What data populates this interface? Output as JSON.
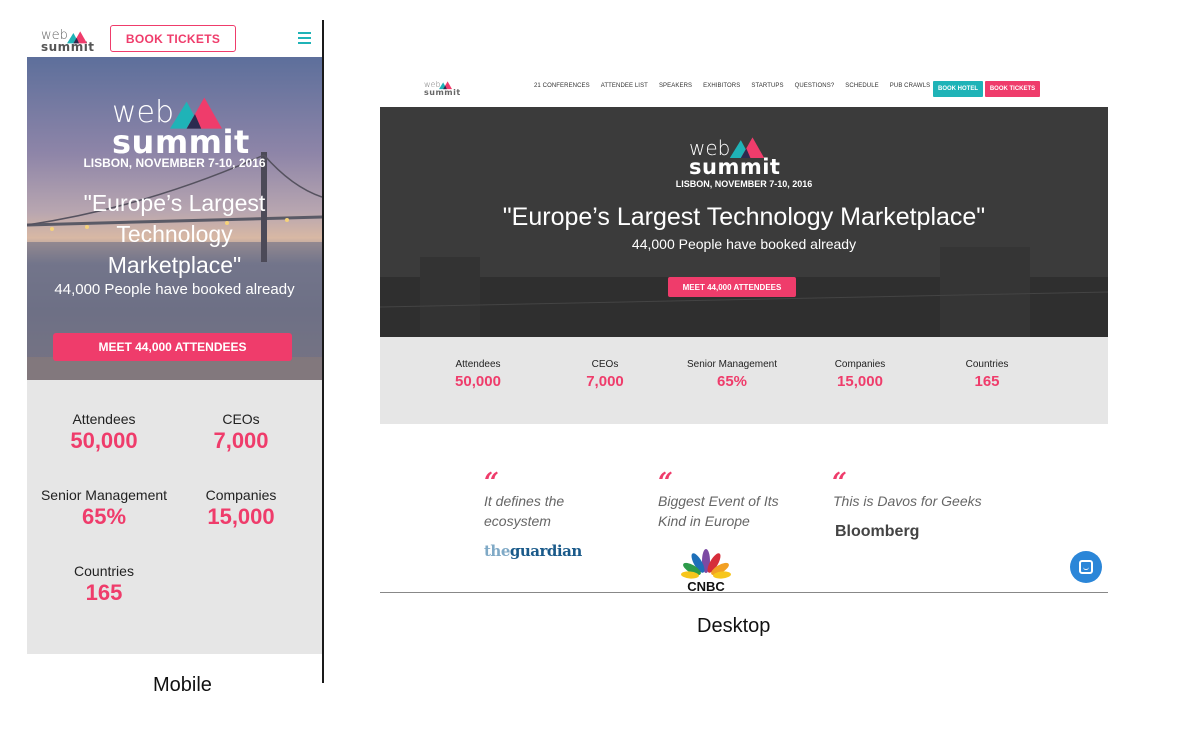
{
  "logo": {
    "word1": "web",
    "word2": "summit"
  },
  "colors": {
    "pink": "#ef3c6b",
    "teal": "#1fb3b7",
    "stats_bg": "#e6e6e6"
  },
  "mobile": {
    "book_tickets": "BOOK TICKETS",
    "date": "LISBON, NOVEMBER 7-10, 2016",
    "quote": "\"Europe’s Largest Technology Marketplace\"",
    "booked": "44,000 People have booked already",
    "meet": "MEET 44,000 ATTENDEES",
    "stats": [
      {
        "label": "Attendees",
        "value": "50,000"
      },
      {
        "label": "CEOs",
        "value": "7,000"
      },
      {
        "label": "Senior Management",
        "value": "65%"
      },
      {
        "label": "Companies",
        "value": "15,000"
      },
      {
        "label": "Countries",
        "value": "165"
      }
    ],
    "caption": "Mobile"
  },
  "desktop": {
    "nav": [
      "21 CONFERENCES",
      "ATTENDEE LIST",
      "SPEAKERS",
      "EXHIBITORS",
      "STARTUPS",
      "QUESTIONS?",
      "SCHEDULE",
      "PUB CRAWLS"
    ],
    "book_hotel": "BOOK HOTEL",
    "book_tickets": "BOOK TICKETS",
    "date": "LISBON, NOVEMBER 7-10, 2016",
    "quote": "\"Europe’s Largest Technology Marketplace\"",
    "booked": "44,000 People have booked already",
    "meet": "MEET 44,000 ATTENDEES",
    "stats": [
      {
        "label": "Attendees",
        "value": "50,000"
      },
      {
        "label": "CEOs",
        "value": "7,000"
      },
      {
        "label": "Senior Management",
        "value": "65%"
      },
      {
        "label": "Companies",
        "value": "15,000"
      },
      {
        "label": "Countries",
        "value": "165"
      }
    ],
    "press": [
      {
        "line1": "It defines the",
        "line2": "ecosystem",
        "source": "theguardian"
      },
      {
        "line1": "Biggest Event of Its",
        "line2": "Kind in Europe",
        "source": "CNBC"
      },
      {
        "line1": "This is Davos for Geeks",
        "line2": "",
        "source": "Bloomberg"
      }
    ],
    "guardian_the": "the",
    "guardian_name": "guardian",
    "caption": "Desktop"
  }
}
